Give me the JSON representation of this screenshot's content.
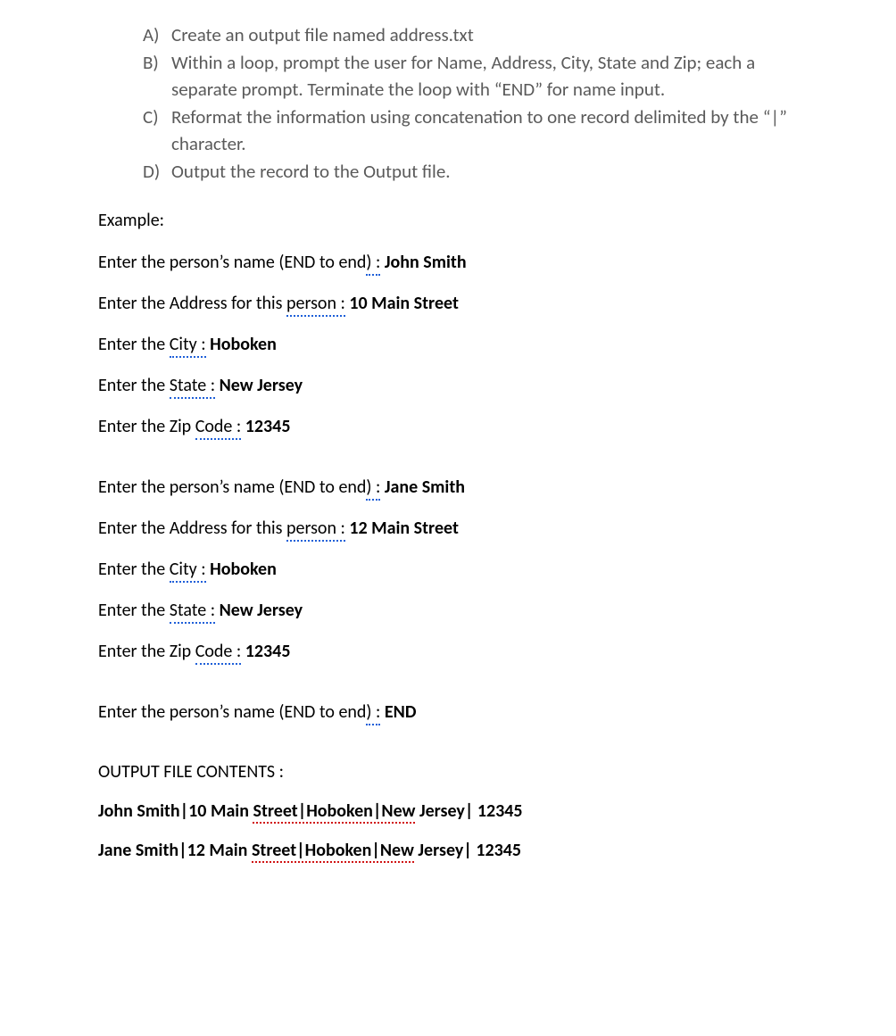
{
  "instructions": [
    {
      "letter": "A)",
      "text": "Create an output file named address.txt"
    },
    {
      "letter": "B)",
      "text": "Within a loop, prompt the user for Name, Address, City, State and Zip; each a separate prompt. Terminate the loop with “END” for name input."
    },
    {
      "letter": "C)",
      "text": "Reformat the information using concatenation to one record delimited by the “|” character."
    },
    {
      "letter": "D)",
      "text": "Output the record to the Output file."
    }
  ],
  "example_label": "Example:",
  "blocks": [
    [
      {
        "pre": "Enter  the person’s name (END to end",
        "squig": ") :",
        "gap": "   ",
        "input": "John Smith"
      },
      {
        "pre": "Enter the Address for this ",
        "squig": "person :",
        "gap": " ",
        "input": "10 Main Street"
      },
      {
        "pre": "Enter the ",
        "squig": "City :",
        "gap": "  ",
        "input": "Hoboken"
      },
      {
        "pre": "Enter the ",
        "squig": "State :",
        "gap": " ",
        "input": "New Jersey"
      },
      {
        "pre": "Enter the Zip ",
        "squig": "Code :",
        "gap": " ",
        "input": "12345"
      }
    ],
    [
      {
        "pre": "Enter the person’s name (END to end",
        "squig": ") :",
        "gap": "   ",
        "input": "Jane Smith"
      },
      {
        "pre": "Enter the Address for this ",
        "squig": "person :",
        "gap": " ",
        "input": "12 Main Street"
      },
      {
        "pre": "Enter the ",
        "squig": "City :",
        "gap": "  ",
        "input": "Hoboken"
      },
      {
        "pre": "Enter the ",
        "squig": "State :",
        "gap": " ",
        "input": "New Jersey"
      },
      {
        "pre": "Enter the Zip ",
        "squig": "Code :",
        "gap": " ",
        "input": "12345"
      }
    ],
    [
      {
        "pre": "Enter the person’s name (END to end",
        "squig": ") :",
        "gap": "   ",
        "input": "END"
      }
    ]
  ],
  "output_heading": "OUTPUT FILE CONTENTS :",
  "output_lines": [
    {
      "p1": "John Smith|10 Main ",
      "r1": "Street|Hoboken|New",
      "p2": " Jersey| 12345"
    },
    {
      "p1": "Jane Smith|12 Main ",
      "r1": "Street|Hoboken|New",
      "p2": " Jersey| 12345"
    }
  ]
}
